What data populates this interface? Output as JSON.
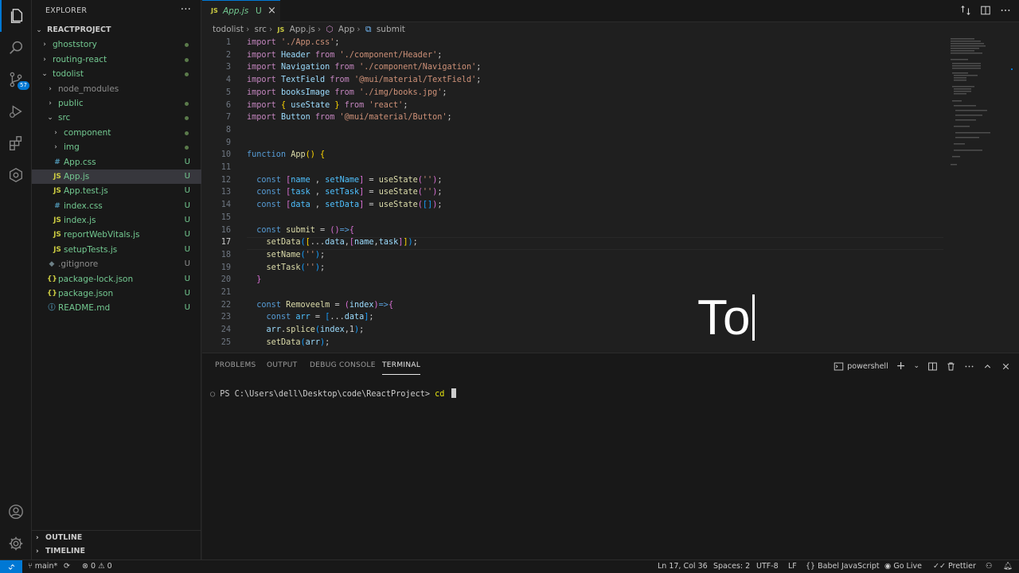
{
  "colors": {
    "accent": "#0078d4",
    "modified_green": "#73c991",
    "background": "#1f1f1f",
    "sidebar": "#181818"
  },
  "activity_bar": {
    "items": [
      "explorer-icon",
      "search-icon",
      "source-control-icon",
      "run-debug-icon",
      "extensions-icon",
      "remote-explorer-icon"
    ],
    "source_control_badge": "57",
    "bottom": [
      "account-icon",
      "settings-gear-icon"
    ]
  },
  "sidebar": {
    "title": "EXPLORER",
    "more": "···",
    "tree": [
      {
        "name": "REACTPROJECT",
        "type": "root",
        "depth": 0
      },
      {
        "name": "ghoststory",
        "type": "folder",
        "depth": 1,
        "dot": true
      },
      {
        "name": "routing-react",
        "type": "folder",
        "depth": 1,
        "dot": true
      },
      {
        "name": "todolist",
        "type": "folder-open",
        "depth": 1,
        "dot": true
      },
      {
        "name": "node_modules",
        "type": "folder",
        "depth": 2
      },
      {
        "name": "public",
        "type": "folder",
        "depth": 2,
        "dot": true
      },
      {
        "name": "src",
        "type": "folder-open",
        "depth": 2,
        "dot": true
      },
      {
        "name": "component",
        "type": "folder",
        "depth": 3,
        "dot": true
      },
      {
        "name": "img",
        "type": "folder",
        "depth": 3,
        "dot": true
      },
      {
        "name": "App.css",
        "type": "css",
        "depth": 3,
        "status": "U"
      },
      {
        "name": "App.js",
        "type": "js",
        "depth": 3,
        "status": "U",
        "selected": true
      },
      {
        "name": "App.test.js",
        "type": "js",
        "depth": 3,
        "status": "U"
      },
      {
        "name": "index.css",
        "type": "css",
        "depth": 3,
        "status": "U"
      },
      {
        "name": "index.js",
        "type": "js",
        "depth": 3,
        "status": "U"
      },
      {
        "name": "reportWebVitals.js",
        "type": "js",
        "depth": 3,
        "status": "U"
      },
      {
        "name": "setupTests.js",
        "type": "js",
        "depth": 3,
        "status": "U"
      },
      {
        "name": ".gitignore",
        "type": "git",
        "depth": 2,
        "status": "U"
      },
      {
        "name": "package-lock.json",
        "type": "json",
        "depth": 2,
        "status": "U"
      },
      {
        "name": "package.json",
        "type": "json",
        "depth": 2,
        "status": "U"
      },
      {
        "name": "README.md",
        "type": "md",
        "depth": 2,
        "status": "U"
      }
    ],
    "outline": "OUTLINE",
    "timeline": "TIMELINE"
  },
  "tab": {
    "file_icon": "JS",
    "name": "App.js",
    "status": "U",
    "close": "×"
  },
  "breadcrumb": [
    "todolist",
    "src",
    "App.js",
    "App",
    "submit"
  ],
  "editor": {
    "current_line": 17,
    "lines": [
      {
        "n": "1",
        "t": [
          [
            "kw",
            "import "
          ],
          [
            "str",
            "'./App.css'"
          ],
          [
            "",
            "; "
          ]
        ]
      },
      {
        "n": "2",
        "t": [
          [
            "kw",
            "import "
          ],
          [
            "var",
            "Header "
          ],
          [
            "kw",
            "from "
          ],
          [
            "str",
            "'./component/Header'"
          ],
          [
            "",
            ";"
          ]
        ]
      },
      {
        "n": "3",
        "t": [
          [
            "kw",
            "import "
          ],
          [
            "var",
            "Navigation "
          ],
          [
            "kw",
            "from "
          ],
          [
            "str",
            "'./component/Navigation'"
          ],
          [
            "",
            ";"
          ]
        ]
      },
      {
        "n": "4",
        "t": [
          [
            "kw",
            "import "
          ],
          [
            "var",
            "TextField "
          ],
          [
            "kw",
            "from "
          ],
          [
            "str",
            "'@mui/material/TextField'"
          ],
          [
            "",
            ";"
          ]
        ]
      },
      {
        "n": "5",
        "t": [
          [
            "kw",
            "import "
          ],
          [
            "var",
            "booksImage "
          ],
          [
            "kw",
            "from "
          ],
          [
            "str",
            "'./img/books.jpg'"
          ],
          [
            "",
            ";"
          ]
        ]
      },
      {
        "n": "6",
        "t": [
          [
            "kw",
            "import "
          ],
          [
            "br1",
            "{ "
          ],
          [
            "var",
            "useState "
          ],
          [
            "br1",
            "} "
          ],
          [
            "kw",
            "from "
          ],
          [
            "str",
            "'react'"
          ],
          [
            "",
            ";"
          ]
        ]
      },
      {
        "n": "7",
        "t": [
          [
            "kw",
            "import "
          ],
          [
            "var",
            "Button "
          ],
          [
            "kw",
            "from "
          ],
          [
            "str",
            "'@mui/material/Button'"
          ],
          [
            "",
            ";"
          ]
        ]
      },
      {
        "n": "8",
        "t": []
      },
      {
        "n": "9",
        "t": []
      },
      {
        "n": "10",
        "t": [
          [
            "kw2",
            "function "
          ],
          [
            "fn",
            "App"
          ],
          [
            "br1",
            "() {"
          ]
        ]
      },
      {
        "n": "11",
        "t": []
      },
      {
        "n": "12",
        "t": [
          [
            "",
            "  "
          ],
          [
            "kw2",
            "const "
          ],
          [
            "br2",
            "["
          ],
          [
            "cst",
            "name "
          ],
          [
            "",
            ", "
          ],
          [
            "cst",
            "setName"
          ],
          [
            "br2",
            "] "
          ],
          [
            "",
            "= "
          ],
          [
            "fn",
            "useState"
          ],
          [
            "br2",
            "("
          ],
          [
            "str",
            "''"
          ],
          [
            "br2",
            ")"
          ],
          [
            "",
            ";"
          ]
        ]
      },
      {
        "n": "13",
        "t": [
          [
            "",
            "  "
          ],
          [
            "kw2",
            "const "
          ],
          [
            "br2",
            "["
          ],
          [
            "cst",
            "task "
          ],
          [
            "",
            ", "
          ],
          [
            "cst",
            "setTask"
          ],
          [
            "br2",
            "] "
          ],
          [
            "",
            "= "
          ],
          [
            "fn",
            "useState"
          ],
          [
            "br2",
            "("
          ],
          [
            "str",
            "''"
          ],
          [
            "br2",
            ")"
          ],
          [
            "",
            ";"
          ]
        ]
      },
      {
        "n": "14",
        "t": [
          [
            "",
            "  "
          ],
          [
            "kw2",
            "const "
          ],
          [
            "br2",
            "["
          ],
          [
            "cst",
            "data "
          ],
          [
            "",
            ", "
          ],
          [
            "cst",
            "setData"
          ],
          [
            "br2",
            "] "
          ],
          [
            "",
            "= "
          ],
          [
            "fn",
            "useState"
          ],
          [
            "br2",
            "("
          ],
          [
            "br3",
            "[]"
          ],
          [
            "br2",
            ")"
          ],
          [
            "",
            ";"
          ]
        ]
      },
      {
        "n": "15",
        "t": []
      },
      {
        "n": "16",
        "t": [
          [
            "",
            "  "
          ],
          [
            "kw2",
            "const "
          ],
          [
            "fn",
            "submit "
          ],
          [
            "",
            "= "
          ],
          [
            "br2",
            "()"
          ],
          [
            "kw2",
            "=>"
          ],
          [
            "br2",
            "{"
          ]
        ]
      },
      {
        "n": "17",
        "t": [
          [
            "",
            "    "
          ],
          [
            "fn",
            "setData"
          ],
          [
            "br3",
            "("
          ],
          [
            "br1",
            "["
          ],
          [
            "",
            "..."
          ],
          [
            "var",
            "data"
          ],
          [
            "",
            ","
          ],
          [
            "br2",
            "["
          ],
          [
            "var",
            "name"
          ],
          [
            "",
            ","
          ],
          [
            "var",
            "task"
          ],
          [
            "br2",
            "]"
          ],
          [
            "br1",
            "]"
          ],
          [
            "br3",
            ")"
          ],
          [
            "",
            ";"
          ]
        ]
      },
      {
        "n": "18",
        "t": [
          [
            "",
            "    "
          ],
          [
            "fn",
            "setName"
          ],
          [
            "br3",
            "("
          ],
          [
            "str",
            "''"
          ],
          [
            "br3",
            ")"
          ],
          [
            "",
            ";"
          ]
        ]
      },
      {
        "n": "19",
        "t": [
          [
            "",
            "    "
          ],
          [
            "fn",
            "setTask"
          ],
          [
            "br3",
            "("
          ],
          [
            "str",
            "''"
          ],
          [
            "br3",
            ")"
          ],
          [
            "",
            ";"
          ]
        ]
      },
      {
        "n": "20",
        "t": [
          [
            "",
            "  "
          ],
          [
            "br2",
            "}"
          ]
        ]
      },
      {
        "n": "21",
        "t": []
      },
      {
        "n": "22",
        "t": [
          [
            "",
            "  "
          ],
          [
            "kw2",
            "const "
          ],
          [
            "fn",
            "Removeelm "
          ],
          [
            "",
            "= "
          ],
          [
            "br2",
            "("
          ],
          [
            "var",
            "index"
          ],
          [
            "br2",
            ")"
          ],
          [
            "kw2",
            "=>"
          ],
          [
            "br2",
            "{"
          ]
        ]
      },
      {
        "n": "23",
        "t": [
          [
            "",
            "    "
          ],
          [
            "kw2",
            "const "
          ],
          [
            "cst",
            "arr "
          ],
          [
            "",
            "= "
          ],
          [
            "br3",
            "["
          ],
          [
            "",
            "..."
          ],
          [
            "var",
            "data"
          ],
          [
            "br3",
            "]"
          ],
          [
            "",
            ";"
          ]
        ]
      },
      {
        "n": "24",
        "t": [
          [
            "",
            "    "
          ],
          [
            "var",
            "arr"
          ],
          [
            "",
            "."
          ],
          [
            "fn",
            "splice"
          ],
          [
            "br3",
            "("
          ],
          [
            "var",
            "index"
          ],
          [
            "",
            ","
          ],
          [
            "",
            "1"
          ],
          [
            "br3",
            ")"
          ],
          [
            "",
            ";"
          ]
        ]
      },
      {
        "n": "25",
        "t": [
          [
            "",
            "    "
          ],
          [
            "fn",
            "setData"
          ],
          [
            "br3",
            "("
          ],
          [
            "var",
            "arr"
          ],
          [
            "br3",
            ")"
          ],
          [
            "",
            ";"
          ]
        ]
      }
    ],
    "overlay_text": "To"
  },
  "panel": {
    "tabs": [
      "PROBLEMS",
      "OUTPUT",
      "DEBUG CONSOLE",
      "TERMINAL"
    ],
    "active_tab": "TERMINAL",
    "shell": "powershell",
    "prompt": "PS C:\\Users\\dell\\Desktop\\code\\ReactProject> ",
    "command": "cd"
  },
  "status": {
    "branch": "main*",
    "problems": "0",
    "warnings": "0",
    "position": "Ln 17, Col 36",
    "spaces": "Spaces: 2",
    "encoding": "UTF-8",
    "eol": "LF",
    "language": "Babel JavaScript",
    "go_live": "Go Live",
    "prettier": "Prettier"
  }
}
